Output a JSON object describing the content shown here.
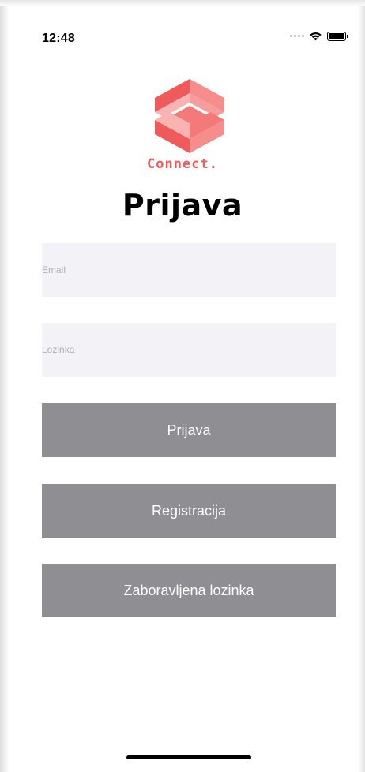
{
  "status_bar": {
    "time": "12:48"
  },
  "logo": {
    "text": "Connect.",
    "color": "#ef5a5a"
  },
  "page_title": "Prijava",
  "form": {
    "email_placeholder": "Email",
    "password_placeholder": "Lozinka"
  },
  "buttons": {
    "login_label": "Prijava",
    "register_label": "Registracija",
    "forgot_label": "Zaboravljena lozinka"
  },
  "colors": {
    "button_bg": "#8e8e93",
    "field_bg": "#f3f2f7",
    "brand": "#ef5a5a"
  }
}
